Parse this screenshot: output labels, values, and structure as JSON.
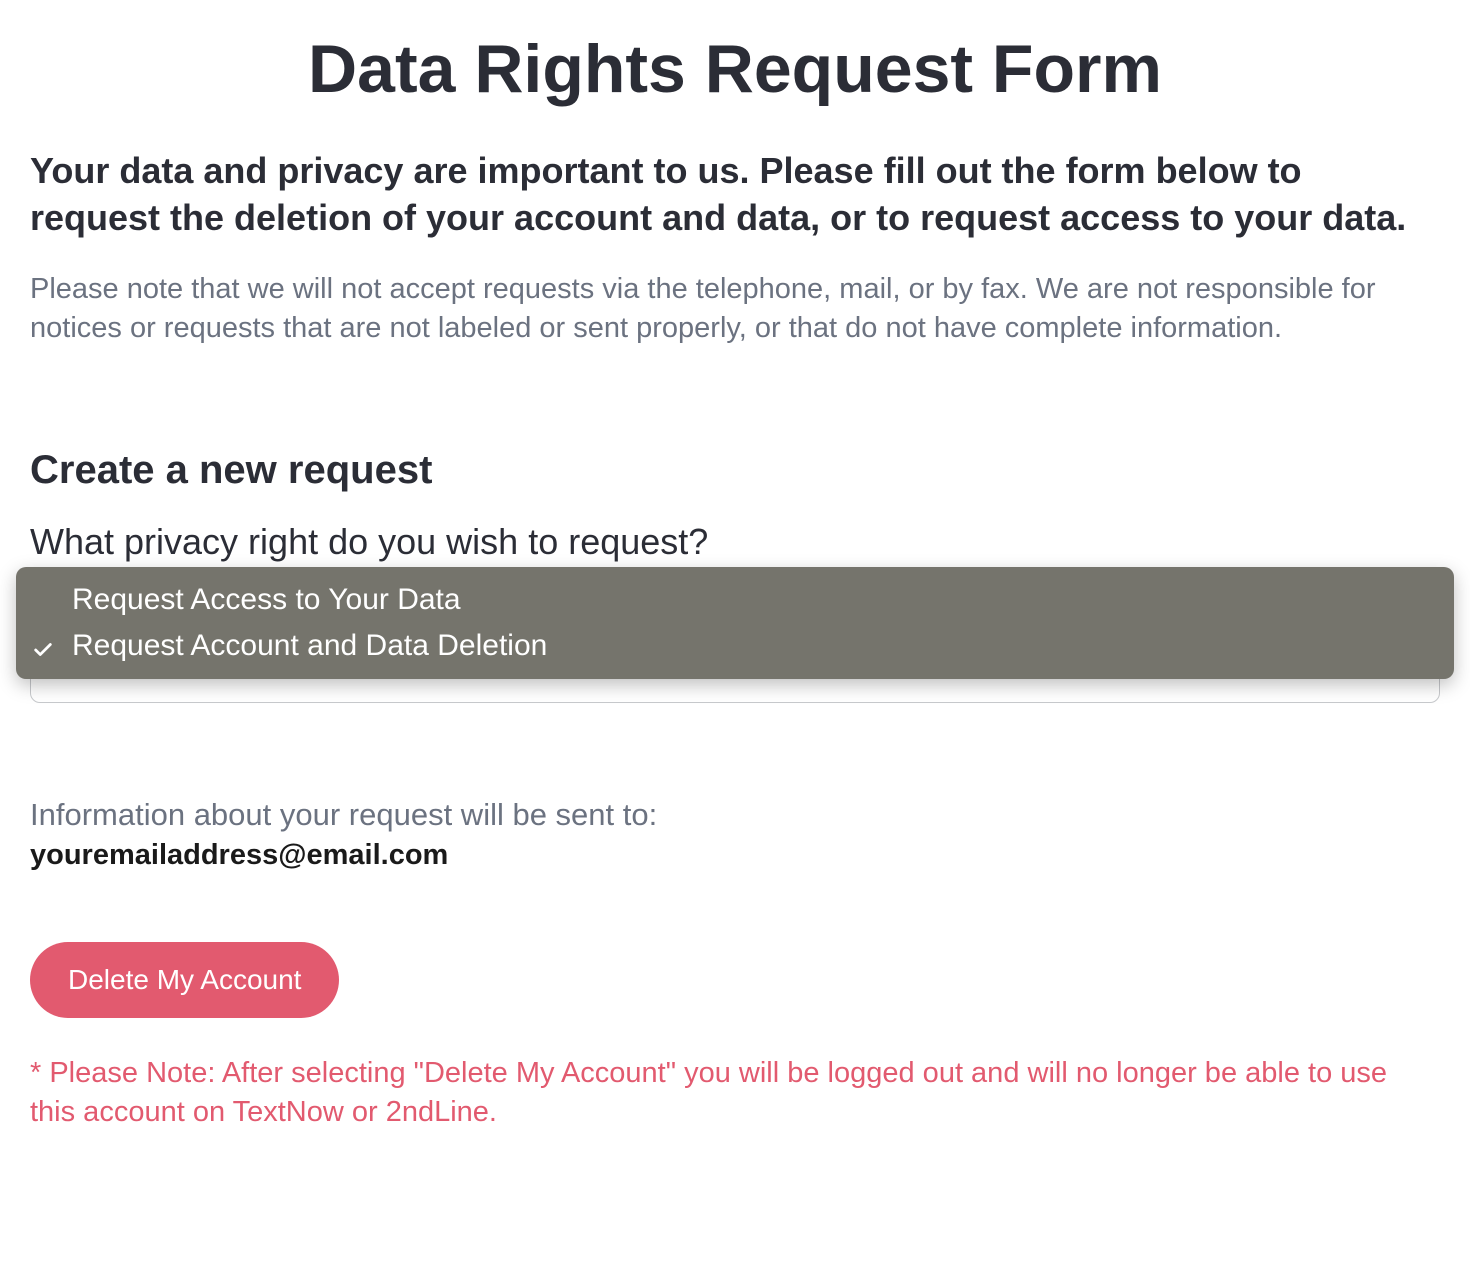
{
  "page_title": "Data Rights Request Form",
  "intro": "Your data and privacy are important to us. Please fill out the form below to request the deletion of your account and data, or to request access to your data.",
  "disclaimer": "Please note that we will not accept requests via the telephone, mail, or by fax. We are not responsible for notices or requests that are not labeled or sent properly, or that do not have complete information.",
  "form": {
    "section_title": "Create a new request",
    "question": "What privacy right do you wish to request?",
    "dropdown": {
      "options": [
        "Request Access to Your Data",
        "Request Account and Data Deletion"
      ],
      "selected_index": 1
    },
    "info_line": "Information about your request will be sent to:",
    "email": "youremailaddress@email.com",
    "submit_label": "Delete My Account",
    "warning": "* Please Note: After selecting \"Delete My Account\" you will be logged out and will no longer be able to use this account on TextNow or 2ndLine."
  },
  "colors": {
    "accent": "#e25a6f",
    "dropdown_bg": "#75746c"
  }
}
